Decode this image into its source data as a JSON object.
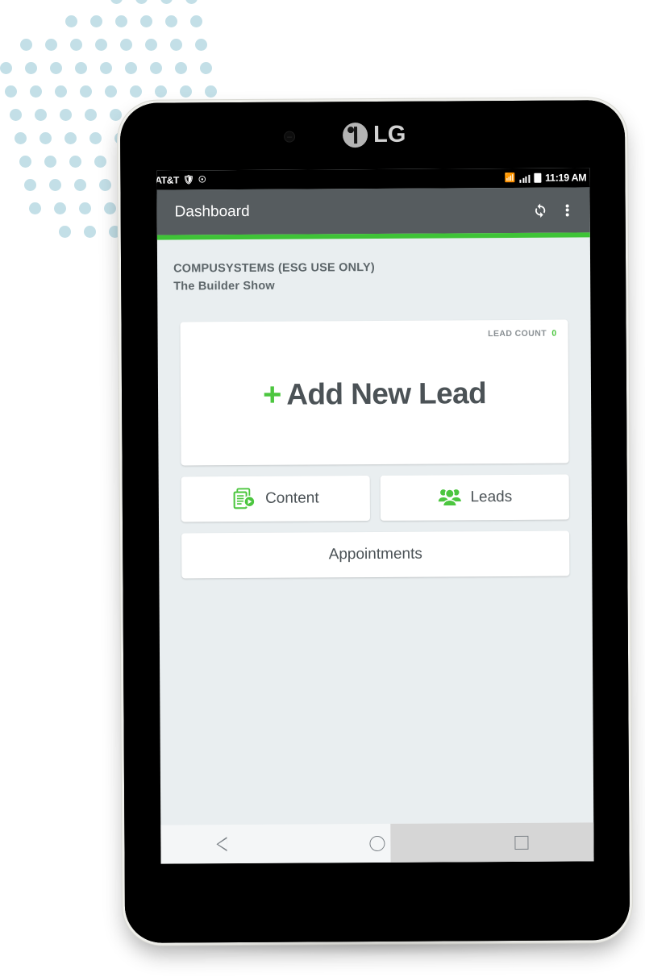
{
  "device": {
    "brand_logo_text": "LG",
    "camera_icon": "camera-dot-icon"
  },
  "status_bar": {
    "carrier": "AT&T",
    "left_icons": [
      "shield-icon",
      "wifi-calling-icon"
    ],
    "right_icons": [
      "data-icon",
      "signal-bars-icon",
      "battery-icon"
    ],
    "time": "11:19 AM"
  },
  "app_bar": {
    "title": "Dashboard",
    "refresh_icon": "refresh-icon",
    "overflow_icon": "overflow-menu-icon",
    "background_color": "#565c5f",
    "accent_color": "#3fc337"
  },
  "content": {
    "organization": "COMPUSYSTEMS (ESG USE ONLY)",
    "event_name": "The Builder Show"
  },
  "add_lead_card": {
    "lead_count_label": "LEAD COUNT",
    "lead_count_value": "0",
    "plus_symbol": "+",
    "label": "Add New Lead",
    "accent_color": "#4cc63f",
    "text_color": "#4b5256"
  },
  "tiles": [
    {
      "label": "Content",
      "icon": "content-documents-play-icon"
    },
    {
      "label": "Leads",
      "icon": "people-group-icon"
    }
  ],
  "appointments": {
    "label": "Appointments"
  },
  "nav_bar": {
    "back_icon": "back-triangle-icon",
    "home_icon": "home-circle-icon",
    "recents_icon": "recents-square-icon"
  },
  "decoration": {
    "dot_color": "#c3dfe7"
  }
}
